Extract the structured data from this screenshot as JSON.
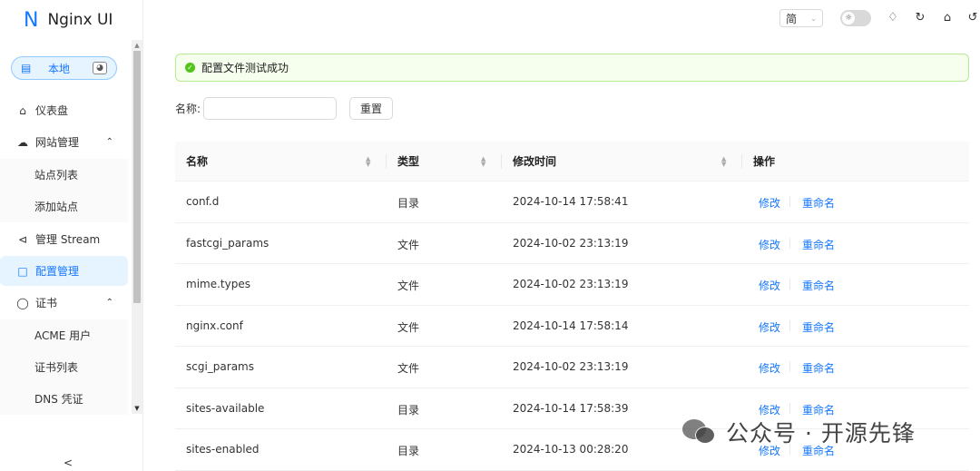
{
  "app": {
    "logo_letter": "N",
    "title": "Nginx UI"
  },
  "env": {
    "label": "本地",
    "icon": "server-icon",
    "badge_icon": "dashboard-badge-icon"
  },
  "menu": {
    "dashboard": "仪表盘",
    "sites": "网站管理",
    "site_list": "站点列表",
    "add_site": "添加站点",
    "stream": "管理 Stream",
    "config": "配置管理",
    "cert": "证书",
    "acme_user": "ACME 用户",
    "cert_list": "证书列表",
    "dns_cred": "DNS 凭证",
    "expand_arrow": "^",
    "collapse": "<"
  },
  "header": {
    "lang": "简",
    "icons": [
      "bell-icon",
      "reload-icon",
      "home-icon",
      "logout-icon"
    ]
  },
  "alert": {
    "text": "配置文件测试成功"
  },
  "filter": {
    "name_label": "名称:",
    "reset_label": "重置"
  },
  "table": {
    "columns": [
      "名称",
      "类型",
      "修改时间",
      "操作"
    ],
    "action_edit": "修改",
    "action_rename": "重命名",
    "rows": [
      {
        "name": "conf.d",
        "type": "目录",
        "modified": "2024-10-14 17:58:41"
      },
      {
        "name": "fastcgi_params",
        "type": "文件",
        "modified": "2024-10-02 23:13:19"
      },
      {
        "name": "mime.types",
        "type": "文件",
        "modified": "2024-10-02 23:13:19"
      },
      {
        "name": "nginx.conf",
        "type": "文件",
        "modified": "2024-10-14 17:58:14"
      },
      {
        "name": "scgi_params",
        "type": "文件",
        "modified": "2024-10-02 23:13:19"
      },
      {
        "name": "sites-available",
        "type": "目录",
        "modified": "2024-10-14 17:58:39"
      },
      {
        "name": "sites-enabled",
        "type": "目录",
        "modified": "2024-10-13 00:28:20"
      }
    ]
  },
  "watermark": {
    "text": "公众号 · 开源先锋"
  }
}
